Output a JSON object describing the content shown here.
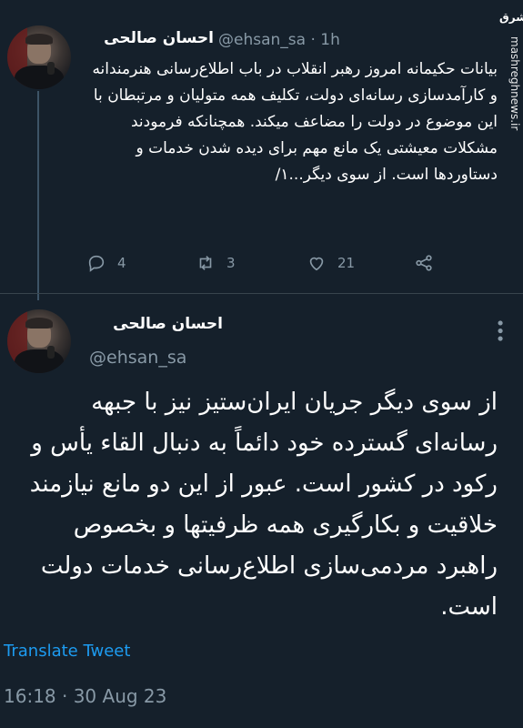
{
  "tweet1": {
    "author_name": "احسان صالحی",
    "handle": "@ehsan_sa",
    "separator": "·",
    "time": "1h",
    "body": "بیانات حکیمانه امروز رهبر انقلاب در باب اطلاع‌رسانی هنرمندانه و کارآمدسازی رسانه‌ای دولت، تکلیف همه متولیان و مرتبطان با این موضوع در دولت را مضاعف میکند. همچنانکه فرمودند مشکلات معیشتی یک مانع مهم برای دیده شدن خدمات و دستاوردها است. از سوی دیگر...۱/",
    "replies": "4",
    "retweets": "3",
    "likes": "21"
  },
  "tweet2": {
    "author_name": "احسان صالحی",
    "handle": "@ehsan_sa",
    "body": "از سوی دیگر جریان ایران‌ستیز نیز با جبهه رسانه‌ای گسترده خود دائماً به دنبال القاء یأس و رکود در کشور است. عبور از این دو مانع نیازمند خلاقیت و بکارگیری همه ظرفیتها و بخصوص راهبرد مردمی‌سازی اطلاع‌رسانی خدمات دولت است.",
    "translate_label": "Translate Tweet",
    "timestamp": "16:18 · 30 Aug 23"
  },
  "watermark": {
    "logo": "مشرق",
    "url": "mashreghnews.ir"
  },
  "icons": {
    "reply": "reply-icon",
    "retweet": "retweet-icon",
    "like": "like-icon",
    "share": "share-icon",
    "more": "more-icon"
  },
  "colors": {
    "background": "#15202b",
    "secondary_text": "#8899a6",
    "link": "#1d9bf0",
    "divider": "#38444d"
  }
}
